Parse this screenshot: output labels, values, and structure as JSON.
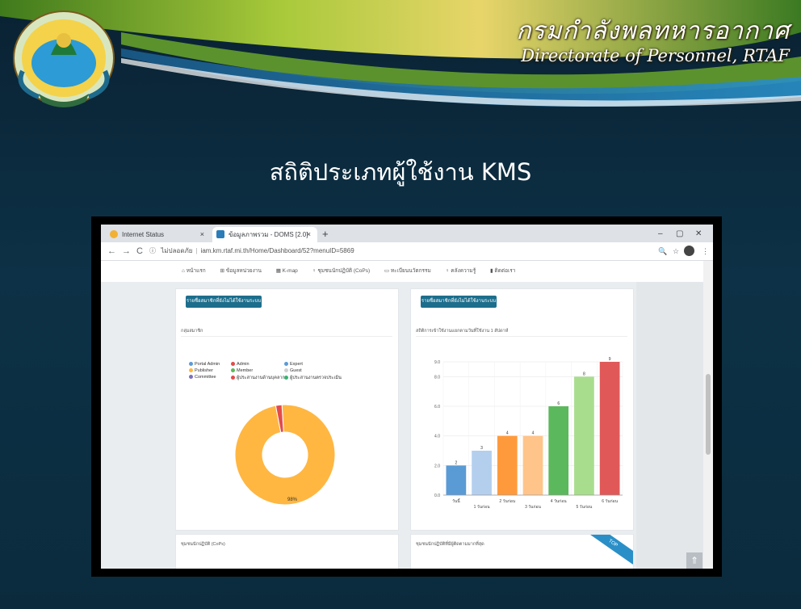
{
  "slide": {
    "brand_thai": "กรมกำลังพลทหารอากาศ",
    "brand_english": "Directorate of Personnel, RTAF",
    "title": "สถิติประเภทผู้ใช้งาน KMS"
  },
  "browser": {
    "tabs": [
      {
        "label": "Internet Status",
        "active": false
      },
      {
        "label": "ข้อมูลภาพรวม - DOMS [2.0]",
        "active": true
      }
    ],
    "new_tab": "+",
    "tab_close": "×",
    "window_controls": [
      "–",
      "▢",
      "✕"
    ],
    "nav": {
      "back": "←",
      "forward": "→",
      "reload": "C",
      "info": "ⓘ"
    },
    "url_security": "ไม่ปลอดภัย",
    "url": "iam.km.rtaf.mi.th/Home/Dashboard/52?menuID=5869",
    "right_icons": [
      "🔍",
      "☆",
      "⋮"
    ]
  },
  "menu": {
    "items": [
      "หน้าแรก",
      "ข้อมูลหน่วยงาน",
      "K-map",
      "ชุมชนนักปฏิบัติ (CoPs)",
      "ทะเบียนนวัตกรรม",
      "คลังความรู้",
      "ติดต่อเรา"
    ]
  },
  "left_panel": {
    "button": "รายชื่อสมาชิกที่ยังไม่ได้ใช้งานระบบ",
    "title": "กลุ่มสมาชิก",
    "legend": [
      {
        "label": "Portal Admin",
        "color": "#5b9bd5"
      },
      {
        "label": "Admin",
        "color": "#e24b4b"
      },
      {
        "label": "Expert",
        "color": "#5b9bd5"
      },
      {
        "label": "Publisher",
        "color": "#ffb742"
      },
      {
        "label": "Member",
        "color": "#5cb85c"
      },
      {
        "label": "Guest",
        "color": "#d0d0d0"
      },
      {
        "label": "Committee",
        "color": "#7a6fbf"
      },
      {
        "label": "ผู้ประสานงานด้านบุคลากร",
        "color": "#e24b4b"
      },
      {
        "label": "ผู้ประสานงานตรวจประเมิน",
        "color": "#3cb371"
      }
    ],
    "donut_label": "98%",
    "bottom_title": "ชุมชนนักปฏิบัติ (CoPs)"
  },
  "right_panel": {
    "button": "รายชื่อสมาชิกที่ยังไม่ได้ใช้งานระบบ",
    "title": "สถิติการเข้าใช้งานแยกตามวันที่ใช้งาน 1 สัปดาห์",
    "bottom_title": "ชุมชนนักปฏิบัติที่มีผู้ติดตามมากที่สุด",
    "ribbon": "TOP"
  },
  "chart_data": {
    "type": "bar",
    "categories": [
      "วันนี้",
      "1 วันก่อน",
      "2 วันก่อน",
      "3 วันก่อน",
      "4 วันก่อน",
      "5 วันก่อน",
      "6 วันก่อน"
    ],
    "values": [
      2,
      3,
      4,
      4,
      6,
      8,
      9
    ],
    "colors": [
      "#5b9bd5",
      "#b4cfee",
      "#ff9a3c",
      "#ffc48a",
      "#5cb85c",
      "#a8dd8e",
      "#e05858"
    ],
    "yticks": [
      "0.0",
      "2.0",
      "4.0",
      "6.0",
      "8.0",
      "9.0"
    ],
    "ylim": [
      0,
      9
    ],
    "grid": true
  },
  "donut_data": {
    "type": "pie",
    "slices": [
      {
        "label": "Publisher",
        "value": 98,
        "color": "#ffb742"
      },
      {
        "label": "Admin",
        "value": 2,
        "color": "#e24b4b"
      }
    ]
  }
}
